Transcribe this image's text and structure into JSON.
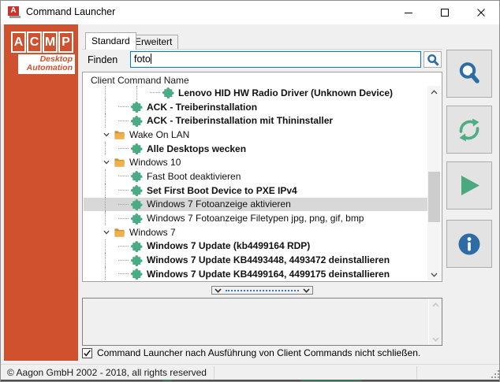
{
  "window": {
    "title": "Command Launcher",
    "controls": {
      "minimize": "minimize",
      "maximize": "maximize",
      "close": "close"
    }
  },
  "sidebar": {
    "logo_letters": [
      "A",
      "C",
      "M",
      "P"
    ],
    "tagline": {
      "line1": "Desktop",
      "line2": "Automation"
    }
  },
  "tabs": [
    {
      "label": "Standard",
      "active": true
    },
    {
      "label": "Erweitert",
      "active": false
    }
  ],
  "search": {
    "label": "Finden",
    "value": "foto",
    "icon": "magnifier-icon"
  },
  "tree": {
    "header": "Client Command Name",
    "rows": [
      {
        "label": "Lenovo HID HW Radio Driver (Unknown Device)",
        "type": "command",
        "level": 3,
        "bold": true,
        "selected": false
      },
      {
        "label": "ACK - Treiberinstallation",
        "type": "command",
        "level": 2,
        "bold": true,
        "selected": false
      },
      {
        "label": "ACK - Treiberinstallation mit Thininstaller",
        "type": "command",
        "level": 2,
        "bold": true,
        "selected": false
      },
      {
        "label": "Wake On LAN",
        "type": "folder",
        "level": 1,
        "bold": false,
        "selected": false,
        "expanded": true
      },
      {
        "label": "Alle Desktops wecken",
        "type": "command",
        "level": 2,
        "bold": true,
        "selected": false
      },
      {
        "label": "Windows 10",
        "type": "folder",
        "level": 1,
        "bold": false,
        "selected": false,
        "expanded": true
      },
      {
        "label": "Fast Boot deaktivieren",
        "type": "command",
        "level": 2,
        "bold": false,
        "selected": false
      },
      {
        "label": "Set First Boot Device to PXE IPv4",
        "type": "command",
        "level": 2,
        "bold": true,
        "selected": false
      },
      {
        "label": "Windows 7 Fotoanzeige aktivieren",
        "type": "command",
        "level": 2,
        "bold": false,
        "selected": true
      },
      {
        "label": "Windows 7 Fotoanzeige Filetypen jpg, png, gif, bmp",
        "type": "command",
        "level": 2,
        "bold": false,
        "selected": false
      },
      {
        "label": "Windows 7",
        "type": "folder",
        "level": 1,
        "bold": false,
        "selected": false,
        "expanded": true
      },
      {
        "label": "Windows 7 Update (kb4499164 RDP)",
        "type": "command",
        "level": 2,
        "bold": true,
        "selected": false
      },
      {
        "label": "Windows 7 Update KB4493448, 4493472 deinstallieren",
        "type": "command",
        "level": 2,
        "bold": true,
        "selected": false
      },
      {
        "label": "Windows 7 Update KB4499164, 4499175 deinstallieren",
        "type": "command",
        "level": 2,
        "bold": true,
        "selected": false
      }
    ]
  },
  "action_buttons": [
    {
      "name": "search",
      "icon": "magnifier-icon"
    },
    {
      "name": "refresh",
      "icon": "refresh-icon"
    },
    {
      "name": "run",
      "icon": "play-icon"
    },
    {
      "name": "info",
      "icon": "info-icon"
    }
  ],
  "options": {
    "close_checkbox": {
      "label": "Command Launcher nach Ausführung von Client Commands nicht schließen.",
      "checked": true
    }
  },
  "statusbar": {
    "copyright": "© Aagon GmbH 2002 - 2018, all rights reserved"
  },
  "colors": {
    "accent_orange": "#d0512d",
    "puzzle_green": "#4aab85",
    "icon_blue": "#2e6da4",
    "folder_orange": "#e9a93f",
    "selection_gray": "#d8d8d8",
    "focus_blue": "#0078d7"
  }
}
